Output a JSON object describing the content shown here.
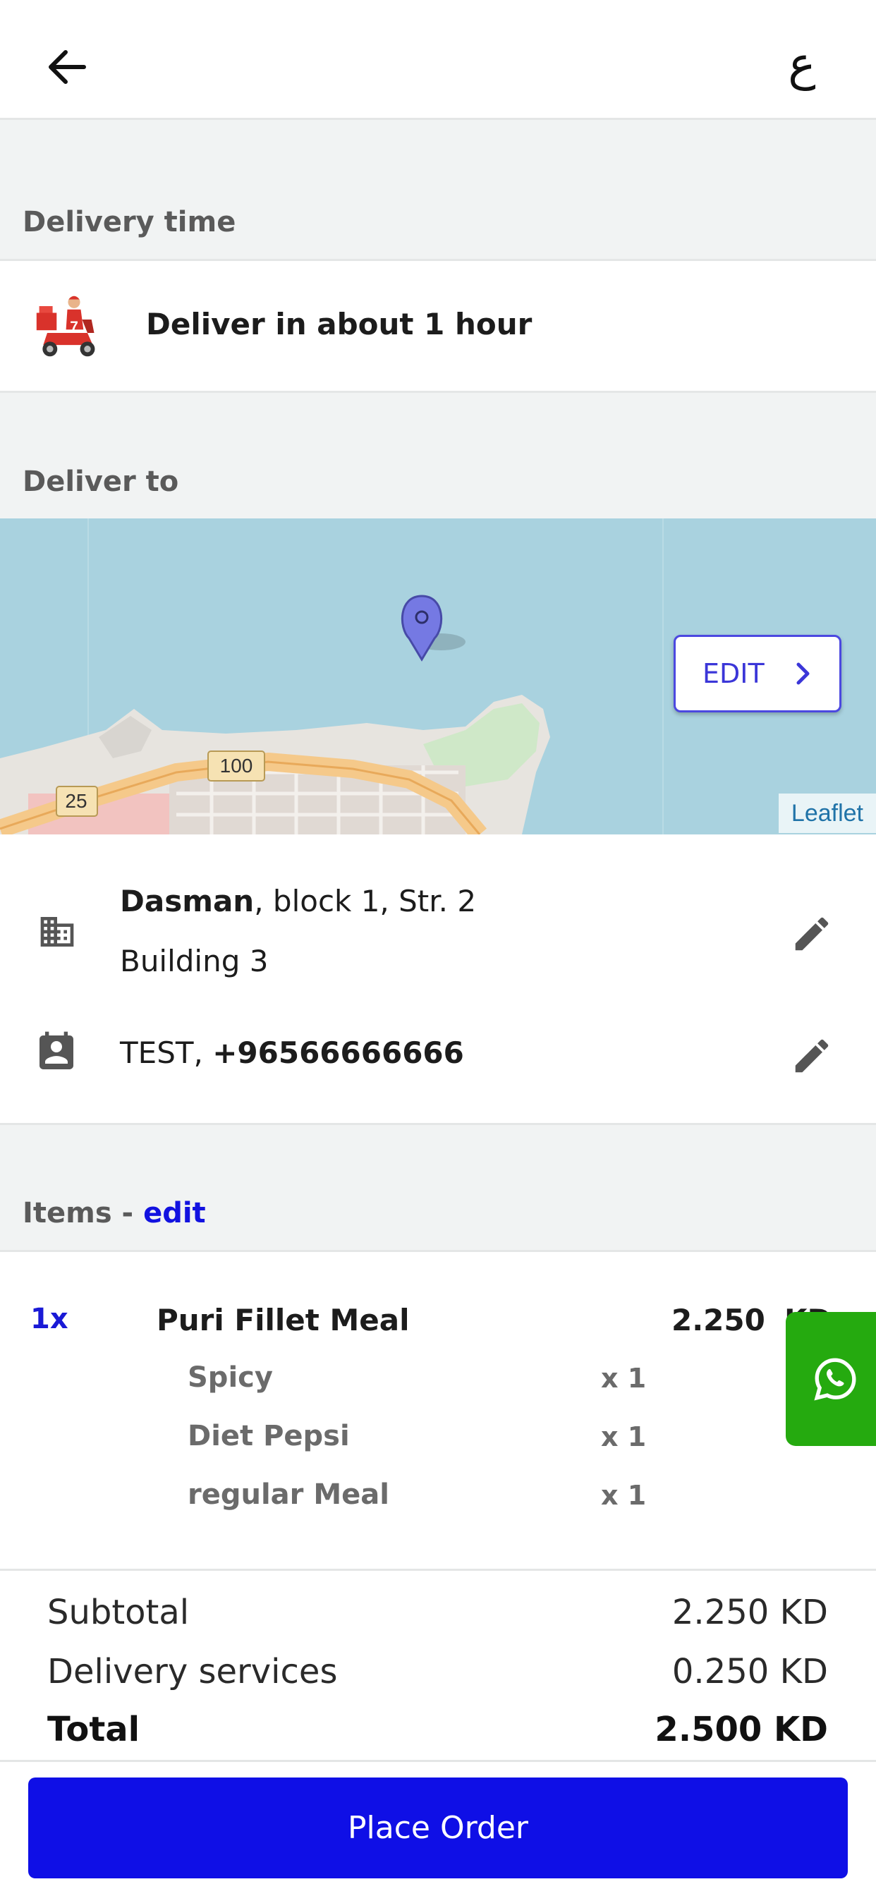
{
  "header": {
    "back_icon": "arrow-left-icon",
    "language_toggle": "ع"
  },
  "delivery_time": {
    "section_label": "Delivery time",
    "icon": "scooter-icon",
    "text": "Deliver in about 1 hour"
  },
  "deliver_to": {
    "section_label": "Deliver to",
    "map": {
      "edit_label": "EDIT",
      "attribution": "Leaflet",
      "labels": [
        "100",
        "25"
      ]
    },
    "address": {
      "area": "Dasman",
      "rest": ", block 1, Str. 2",
      "line2": "Building 3"
    },
    "contact": {
      "name": "TEST, ",
      "phone": "+96566666666"
    }
  },
  "items": {
    "section_label": "Items - ",
    "edit_label": "edit",
    "list": [
      {
        "qty": "1x",
        "name": "Puri Fillet Meal",
        "price": "2.250",
        "currency": "KD",
        "options": [
          {
            "name": "Spicy",
            "qty": "x 1"
          },
          {
            "name": "Diet Pepsi",
            "qty": "x 1"
          },
          {
            "name": "regular Meal",
            "qty": "x 1"
          }
        ]
      }
    ]
  },
  "totals": {
    "subtotal_label": "Subtotal",
    "subtotal_value": "2.250 KD",
    "delivery_label": "Delivery services",
    "delivery_value": "0.250 KD",
    "total_label": "Total",
    "total_value": "2.500 KD"
  },
  "place_order_label": "Place Order",
  "colors": {
    "accent": "#0f0fe6",
    "whatsapp": "#25aa0f",
    "map_water": "#a9d2df"
  }
}
